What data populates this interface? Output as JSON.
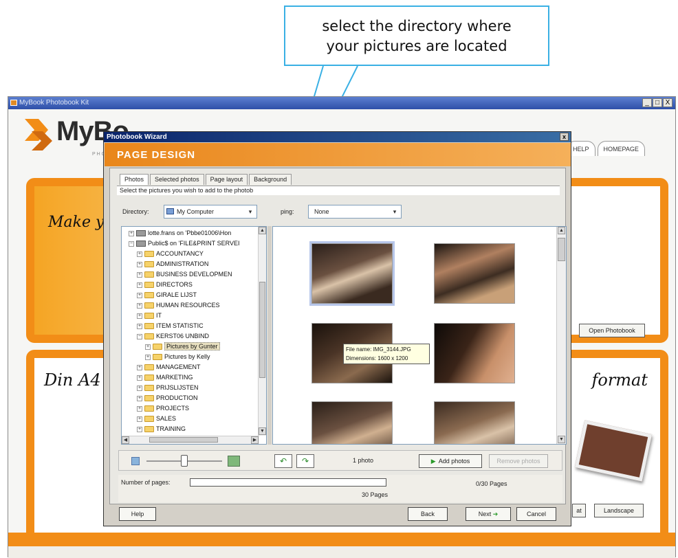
{
  "callout": {
    "line1": "select the directory where",
    "line2": "your pictures are located"
  },
  "main_window": {
    "title": "MyBook Photobook Kit",
    "controls": [
      "_",
      "□",
      "X"
    ],
    "logo_text": "MyBo",
    "logo_sub": "PHOTO",
    "top_tabs": [
      "HELP",
      "HOMEPAGE"
    ],
    "panel1_text": "Make you",
    "panel2_text_left": "Din A4",
    "panel2_text_right": "format",
    "open_button": "Open Photobook",
    "partial_button": "at",
    "landscape_button": "Landscape"
  },
  "wizard": {
    "title": "Photobook Wizard",
    "close": "x",
    "heading": "PAGE DESIGN",
    "tabs": [
      "Photos",
      "Selected photos",
      "Page layout",
      "Background"
    ],
    "instruction": "Select the pictures you wish to add to the photob",
    "directory_label": "Directory:",
    "directory_value": "My Computer",
    "grouping_label": "ping:",
    "grouping_value": "None",
    "tree": [
      "lotte.frans on 'Pbbe01006\\Hon",
      "Public$ on 'FILE&PRINT SERVEI",
      "ACCOUNTANCY",
      "ADMINISTRATION",
      "BUSINESS DEVELOPMEN",
      "DIRECTORS",
      "GIRALE LIJST",
      "HUMAN RESOURCES",
      "IT",
      "ITEM STATISTIC",
      "KERST06 UNBIND",
      "Pictures by Gunter",
      "Pictures by Kelly",
      "MANAGEMENT",
      "MARKETING",
      "PRIJSLIJSTEN",
      "PRODUCTION",
      "PROJECTS",
      "SALES",
      "TRAINING"
    ],
    "tooltip": {
      "line1": "File name: IMG_3144.JPG",
      "line2": "Dimensions: 1600 x 1200"
    },
    "photo_count": "1 photo",
    "add_button": "Add photos",
    "remove_button": "Remove photos",
    "pages_label": "Number of pages:",
    "pages_total": "30 Pages",
    "pages_of": "0/30 Pages",
    "pages_progress": 0,
    "help_button": "Help",
    "back_button": "Back",
    "next_button": "Next",
    "cancel_button": "Cancel"
  },
  "colors": {
    "accent": "#f28d17",
    "callout_border": "#39b0e4",
    "wizard_title": "#0a246a"
  }
}
